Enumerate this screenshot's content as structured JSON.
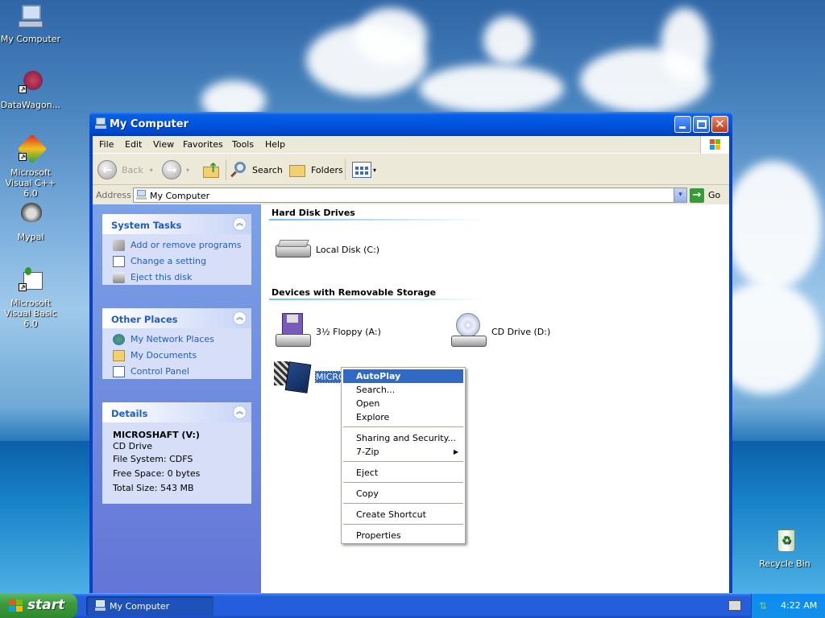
{
  "desktop": {
    "icons": [
      {
        "label": "My Computer"
      },
      {
        "label": "DataWagon..."
      },
      {
        "label": "Microsoft Visual C++ 6.0"
      },
      {
        "label": "Mypal"
      },
      {
        "label": "Microsoft Visual Basic 6.0"
      },
      {
        "label": "Recycle Bin"
      }
    ]
  },
  "window": {
    "title": "My Computer",
    "menu": [
      "File",
      "Edit",
      "View",
      "Favorites",
      "Tools",
      "Help"
    ],
    "toolbar": {
      "back": "Back",
      "search": "Search",
      "folders": "Folders"
    },
    "address": {
      "label": "Address",
      "value": "My Computer",
      "go": "Go"
    },
    "panels": {
      "system_tasks": {
        "title": "System Tasks",
        "links": [
          "Add or remove programs",
          "Change a setting",
          "Eject this disk"
        ]
      },
      "other_places": {
        "title": "Other Places",
        "links": [
          "My Network Places",
          "My Documents",
          "Control Panel"
        ]
      },
      "details": {
        "title": "Details",
        "name": "MICROSHAFT (V:)",
        "type": "CD Drive",
        "filesystem": "File System: CDFS",
        "free": "Free Space: 0 bytes",
        "total": "Total Size: 543 MB"
      }
    },
    "groups": {
      "hard_disks": {
        "title": "Hard Disk Drives",
        "items": [
          "Local Disk (C:)"
        ]
      },
      "removable": {
        "title": "Devices with Removable Storage",
        "items": [
          "3½ Floppy (A:)",
          "CD Drive (D:)",
          "MICRO"
        ]
      }
    }
  },
  "context_menu": {
    "items": [
      "AutoPlay",
      "Search...",
      "Open",
      "Explore",
      "Sharing and Security...",
      "7-Zip",
      "Eject",
      "Copy",
      "Create Shortcut",
      "Properties"
    ],
    "selected": "AutoPlay"
  },
  "taskbar": {
    "start": "start",
    "task": "My Computer",
    "clock": "4:22 AM"
  },
  "colors": {
    "title_blue": "#0055e0",
    "link_blue": "#215dc6",
    "selection": "#316ac5",
    "start_green": "#3c9a3c"
  }
}
